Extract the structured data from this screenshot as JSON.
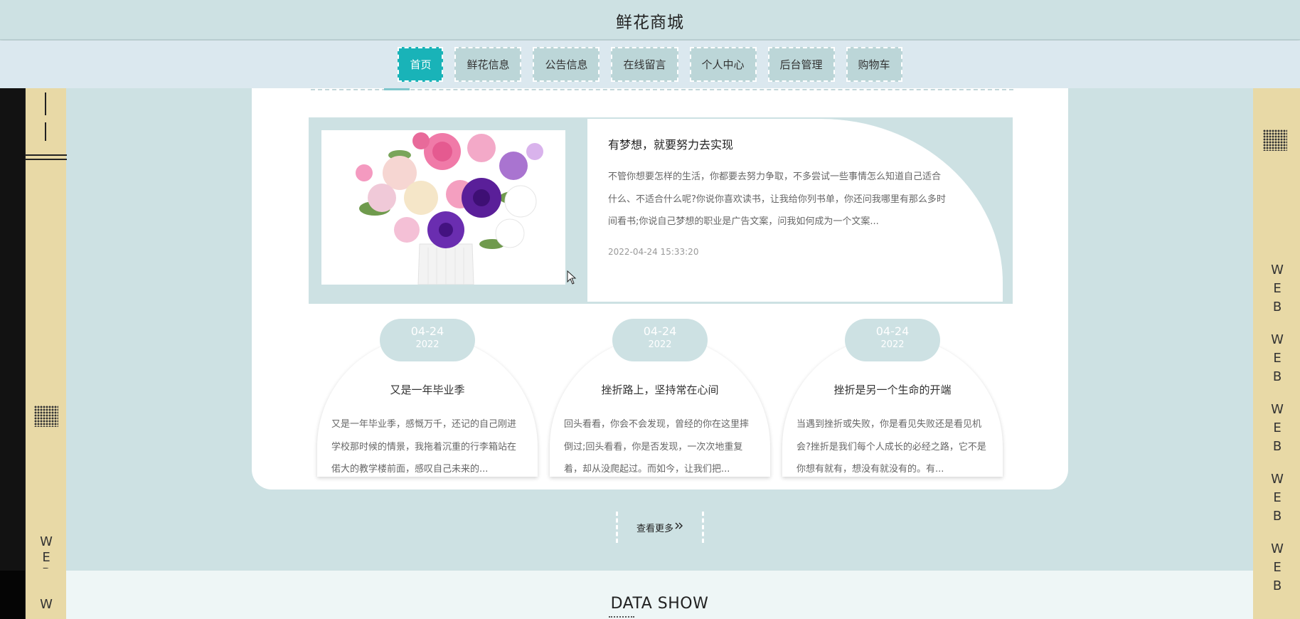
{
  "header": {
    "title": "鲜花商城"
  },
  "nav": {
    "items": [
      {
        "label": "首页",
        "active": true
      },
      {
        "label": "鲜花信息"
      },
      {
        "label": "公告信息"
      },
      {
        "label": "在线留言"
      },
      {
        "label": "个人中心"
      },
      {
        "label": "后台管理"
      },
      {
        "label": "购物车"
      }
    ]
  },
  "feature": {
    "title": "有梦想，就要努力去实现",
    "text": "不管你想要怎样的生活，你都要去努力争取，不多尝试一些事情怎么知道自己适合什么、不适合什么呢?你说你喜欢读书，让我给你列书单，你还问我哪里有那么多时间看书;你说自己梦想的职业是广告文案，问我如何成为一个文案...",
    "date": "2022-04-24 15:33:20"
  },
  "cards": [
    {
      "month_day": "04-24",
      "year": "2022",
      "title": "又是一年毕业季",
      "text": "又是一年毕业季，感慨万千，还记的自己刚进学校那时候的情景，我拖着沉重的行李箱站在偌大的教学楼前面，感叹自己未来的..."
    },
    {
      "month_day": "04-24",
      "year": "2022",
      "title": "挫折路上，坚持常在心间",
      "text": "回头看看，你会不会发现，曾经的你在这里摔倒过;回头看看，你是否发现，一次次地重复着，却从没爬起过。而如今，让我们把..."
    },
    {
      "month_day": "04-24",
      "year": "2022",
      "title": "挫折是另一个生命的开端",
      "text": "当遇到挫折或失败，你是看见失败还是看见机会?挫折是我们每个人成长的必经之路，它不是你想有就有，想没有就没有的。有..."
    }
  ],
  "more": {
    "label": "查看更多",
    "icon": "double-chevron-right-icon"
  },
  "data_show": {
    "title": "DATA SHOW"
  },
  "side": {
    "right_web": [
      "W",
      "E",
      "B",
      "W",
      "E",
      "B",
      "W",
      "E",
      "B",
      "W",
      "E",
      "B",
      "W",
      "E",
      "B"
    ],
    "left_web": [
      "W",
      "E",
      "B",
      "W"
    ]
  },
  "colors": {
    "accent": "#19b3b8",
    "bg": "#cde1e3",
    "side": "#e8d9a6"
  }
}
